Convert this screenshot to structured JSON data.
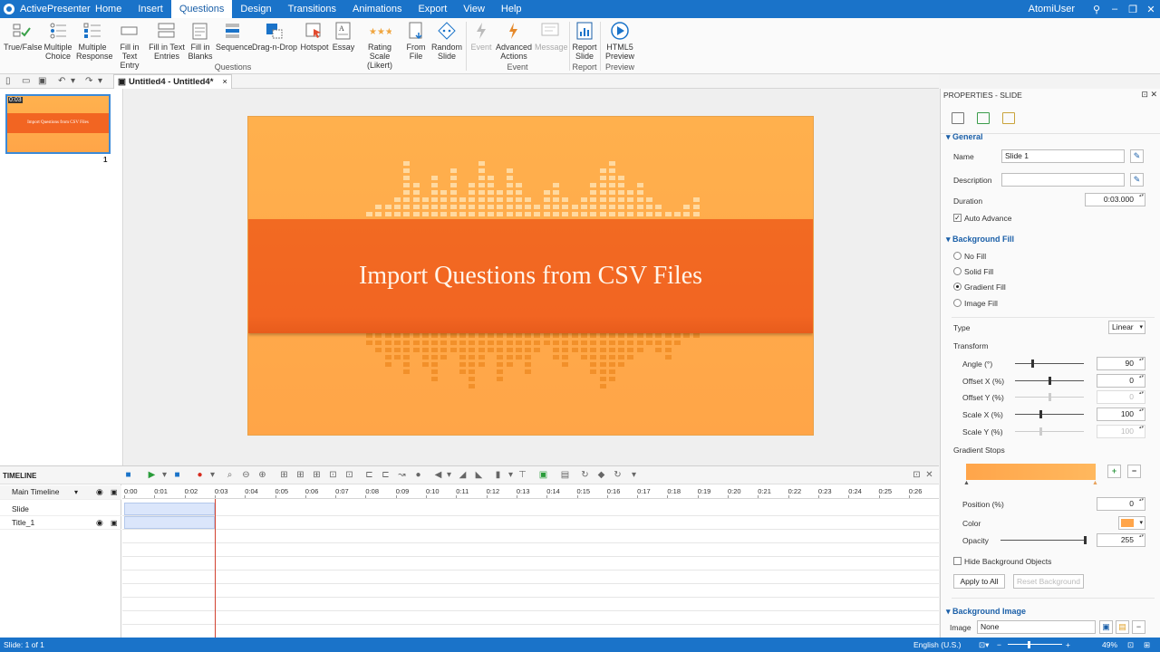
{
  "window": {
    "app_name": "ActivePresenter",
    "user": "AtomiUser",
    "menu_tabs": [
      "Home",
      "Insert",
      "Questions",
      "Design",
      "Transitions",
      "Animations",
      "Export",
      "View",
      "Help"
    ],
    "active_tab": "Questions"
  },
  "ribbon": {
    "questions": [
      {
        "label": "True/False",
        "icon": "true-false-icon"
      },
      {
        "label": "Multiple Choice",
        "icon": "multiple-choice-icon"
      },
      {
        "label": "Multiple Response",
        "icon": "multiple-response-icon"
      },
      {
        "label": "Fill in Text Entry",
        "icon": "text-entry-icon"
      },
      {
        "label": "Fill in Text Entries",
        "icon": "text-entries-icon"
      },
      {
        "label": "Fill in Blanks",
        "icon": "blanks-icon"
      },
      {
        "label": "Sequence",
        "icon": "sequence-icon"
      },
      {
        "label": "Drag-n-Drop",
        "icon": "drag-drop-icon"
      },
      {
        "label": "Hotspot",
        "icon": "hotspot-icon"
      },
      {
        "label": "Essay",
        "icon": "essay-icon"
      },
      {
        "label": "Rating Scale (Likert)",
        "icon": "rating-scale-icon"
      },
      {
        "label": "From File",
        "icon": "from-file-icon"
      },
      {
        "label": "Random Slide",
        "icon": "random-slide-icon"
      }
    ],
    "event": [
      {
        "label": "Event",
        "icon": "event-icon"
      },
      {
        "label": "Advanced Actions",
        "icon": "advanced-actions-icon"
      },
      {
        "label": "Message",
        "icon": "message-icon"
      }
    ],
    "report": [
      {
        "label": "Report Slide",
        "icon": "report-slide-icon"
      }
    ],
    "preview": [
      {
        "label": "HTML5 Preview",
        "icon": "html5-preview-icon"
      }
    ],
    "group_labels": {
      "questions": "Questions",
      "event": "Event",
      "report": "Report",
      "preview": "Preview"
    }
  },
  "document": {
    "tab_title": "Untitled4 - Untitled4*",
    "close": "×"
  },
  "slides": [
    {
      "number": "1",
      "duration": "0:03",
      "title": "Import Questions from CSV Files"
    }
  ],
  "slide": {
    "title": "Import Questions from CSV Files"
  },
  "properties": {
    "header": "PROPERTIES - SLIDE",
    "general": {
      "title": "General",
      "name_label": "Name",
      "name_value": "Slide 1",
      "description_label": "Description",
      "description_value": "",
      "duration_label": "Duration",
      "duration_value": "0:03.000",
      "auto_advance": "Auto Advance"
    },
    "background_fill": {
      "title": "Background Fill",
      "options": [
        "No Fill",
        "Solid Fill",
        "Gradient Fill",
        "Image Fill"
      ],
      "selected": "Gradient Fill",
      "type_label": "Type",
      "type_value": "Linear",
      "transform_label": "Transform",
      "angle_label": "Angle (°)",
      "angle_value": "90",
      "offset_x_label": "Offset X (%)",
      "offset_x_value": "0",
      "offset_y_label": "Offset Y (%)",
      "offset_y_value": "0",
      "scale_x_label": "Scale X (%)",
      "scale_x_value": "100",
      "scale_y_label": "Scale Y (%)",
      "scale_y_value": "100",
      "gradient_stops_label": "Gradient Stops",
      "position_label": "Position (%)",
      "position_value": "0",
      "color_label": "Color",
      "color_value": "#ffa54a",
      "opacity_label": "Opacity",
      "opacity_value": "255",
      "hide_bg_objects": "Hide Background Objects",
      "apply_all": "Apply to All",
      "reset_bg": "Reset Background"
    },
    "background_image": {
      "title": "Background Image",
      "image_label": "Image",
      "image_value": "None"
    }
  },
  "timeline": {
    "title": "TIMELINE",
    "main": "Main Timeline",
    "rows": [
      "Slide",
      "Title_1"
    ],
    "ticks": [
      "0:00",
      "0:01",
      "0:02",
      "0:03",
      "0:04",
      "0:05",
      "0:06",
      "0:07",
      "0:08",
      "0:09",
      "0:10",
      "0:11",
      "0:12",
      "0:13",
      "0:14",
      "0:15",
      "0:16",
      "0:17",
      "0:18",
      "0:19",
      "0:20",
      "0:21",
      "0:22",
      "0:23",
      "0:24",
      "0:25",
      "0:26"
    ]
  },
  "status": {
    "slide": "Slide: 1 of 1",
    "language": "English (U.S.)",
    "zoom": "49%"
  },
  "colors": {
    "accent": "#1a73c9",
    "slide_bg": "#ffa548",
    "slide_band": "#f26522"
  }
}
